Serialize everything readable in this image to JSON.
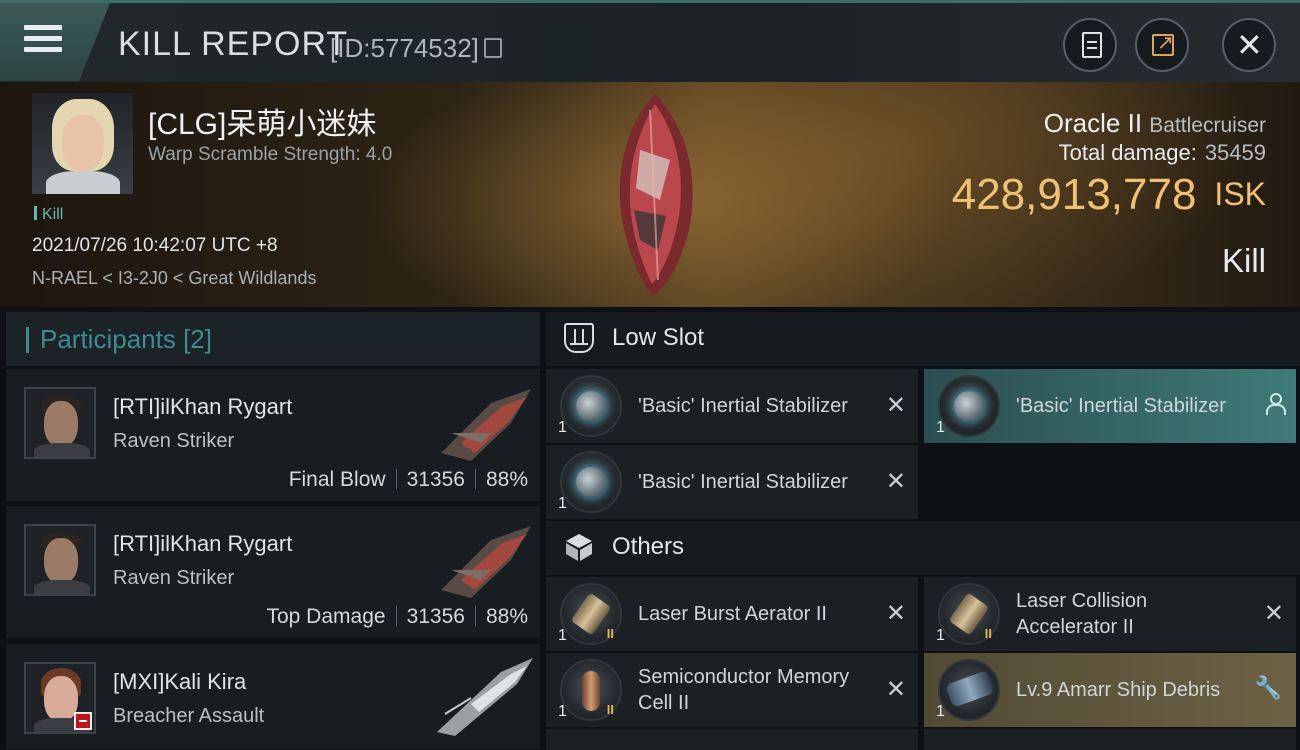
{
  "header": {
    "title": "KILL REPORT",
    "report_id": "[ID:5774532]"
  },
  "victim": {
    "name": "[CLG]呆萌小迷妹",
    "warp_scramble": "Warp Scramble Strength: 4.0",
    "tag": "Kill",
    "datetime": "2021/07/26 10:42:07 UTC +8",
    "location": "N-RAEL < I3-2J0 < Great Wildlands",
    "ship_name": "Oracle II",
    "ship_class": "Battlecruiser",
    "total_damage_label": "Total damage:",
    "total_damage": "35459",
    "isk_value": "428,913,778",
    "isk_currency": "ISK",
    "kill_type": "Kill"
  },
  "participants": {
    "label": "Participants [2]",
    "items": [
      {
        "name": "[RTI]ilKhan Rygart",
        "ship": "Raven Striker",
        "role": "Final Blow",
        "damage": "31356",
        "percent": "88%"
      },
      {
        "name": "[RTI]ilKhan Rygart",
        "ship": "Raven Striker",
        "role": "Top Damage",
        "damage": "31356",
        "percent": "88%"
      },
      {
        "name": "[MXI]Kali Kira",
        "ship": "Breacher Assault"
      }
    ]
  },
  "low_slot": {
    "label": "Low Slot",
    "items": [
      {
        "name": "'Basic' Inertial Stabilizer",
        "qty": "1"
      },
      {
        "name": "'Basic' Inertial Stabilizer",
        "qty": "1"
      },
      {
        "name": "'Basic' Inertial Stabilizer",
        "qty": "1"
      }
    ]
  },
  "others": {
    "label": "Others",
    "items": [
      {
        "name": "Laser Burst Aerator II",
        "qty": "1",
        "tier": "II"
      },
      {
        "name": "Laser Collision Accelerator II",
        "qty": "1",
        "tier": "II"
      },
      {
        "name": "Semiconductor Memory Cell II",
        "qty": "1",
        "tier": "II"
      },
      {
        "name": "Lv.9 Amarr Ship Debris",
        "qty": "1"
      }
    ]
  },
  "icons": {
    "x": "✕",
    "wrench": "🔧",
    "close": "✕"
  },
  "colors": {
    "accent_teal": "#3f8b8f",
    "isk_gold": "#f1c173",
    "kill_tag": "#68b7aa"
  }
}
